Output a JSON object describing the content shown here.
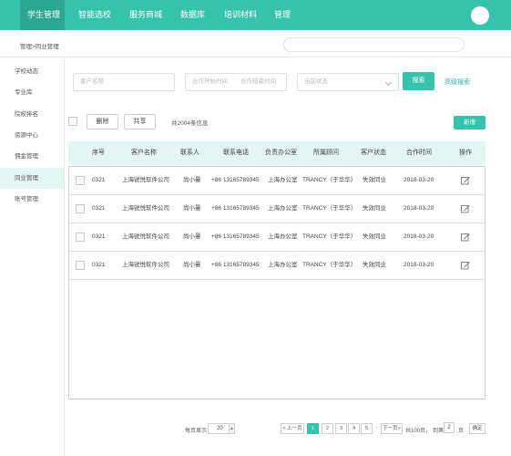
{
  "nav": {
    "items": [
      "学生管理",
      "智能选校",
      "服务商城",
      "数据库",
      "培训材料",
      "管理"
    ]
  },
  "breadcrumb": "管理>同业管理",
  "sidebar": {
    "items": [
      "学校动态",
      "专业库",
      "院校排名",
      "资源中心",
      "佣金管理",
      "同业管理",
      "账号管理"
    ],
    "active": "同业管理"
  },
  "filters": {
    "customer_placeholder": "客户名称",
    "start_time_placeholder": "合作开始时间",
    "end_time_placeholder": "合作结束时间",
    "status_placeholder": "当前状态",
    "search_label": "搜索",
    "advanced_label": "高级搜索"
  },
  "toolbar": {
    "delete_label": "删除",
    "share_label": "共享",
    "total_text": "共2004条信息",
    "new_label": "新增"
  },
  "table": {
    "headers": [
      "序号",
      "客户名称",
      "联系人",
      "联系电话",
      "负责办公室",
      "所属顾问",
      "客户状态",
      "合作时间",
      "操作"
    ],
    "rows": [
      [
        "0321",
        "上海锐悦软件公司",
        "尚小曼",
        "+86 13165789345",
        "上海办公室",
        "TRANCY（于华华）",
        "失效同业",
        "2018-03-20"
      ],
      [
        "0321",
        "上海锐悦软件公司",
        "尚小曼",
        "+86 13165789345",
        "上海办公室",
        "TRANCY（于华华）",
        "失效同业",
        "2018-03-20"
      ],
      [
        "0321",
        "上海锐悦软件公司",
        "尚小曼",
        "+86 13165789345",
        "上海办公室",
        "TRANCY（于华华）",
        "失效同业",
        "2018-03-20"
      ],
      [
        "0321",
        "上海锐悦软件公司",
        "尚小曼",
        "+86 13165789345",
        "上海办公室",
        "TRANCY（于华华）",
        "失效同业",
        "2018-03-20"
      ]
    ]
  },
  "pagination": {
    "per_page_label": "每页显示",
    "per_page_value": "20",
    "prev_label": "< 上一页",
    "pages": [
      "1",
      "2",
      "3",
      "4",
      "5"
    ],
    "current_page": "1",
    "ellipsis": "···",
    "next_label": "下一页>",
    "total_pages_text": "共100页，",
    "goto_label": "到第",
    "goto_value": "2",
    "page_suffix": "页",
    "confirm_label": "确定"
  },
  "colors": {
    "accent": "#35c3ad",
    "nav_active": "#2aa894",
    "header_bg": "#e4f6f3"
  }
}
